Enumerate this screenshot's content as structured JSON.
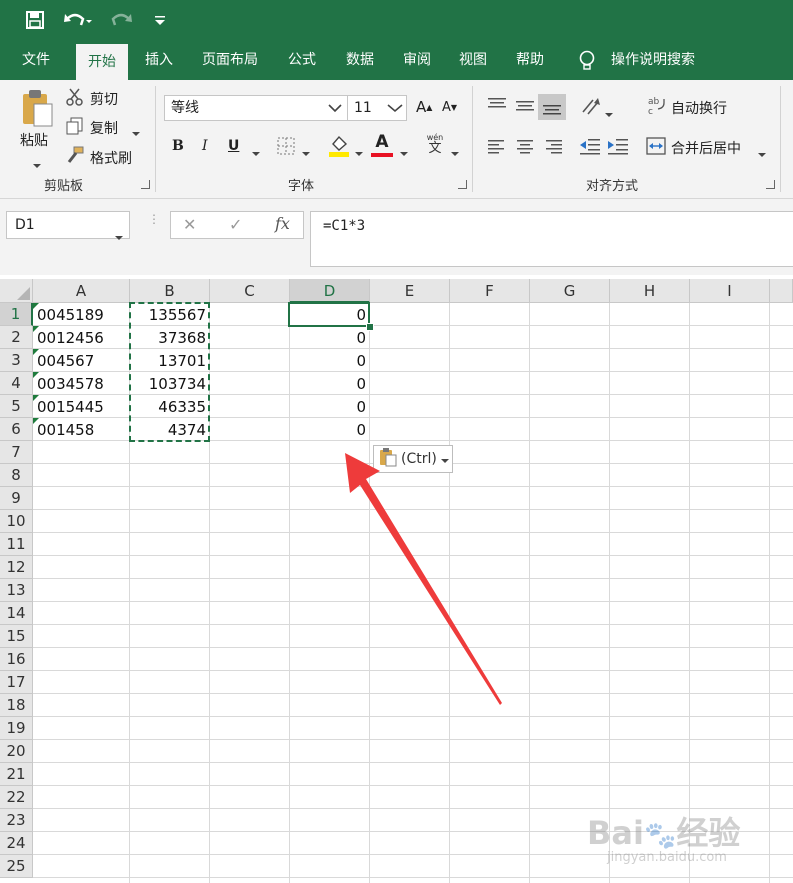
{
  "quick_access": {
    "save_icon": "save-icon",
    "undo_icon": "undo-icon",
    "redo_icon": "redo-icon",
    "customize_icon": "customize-icon"
  },
  "menu": {
    "tabs": [
      "文件",
      "开始",
      "插入",
      "页面布局",
      "公式",
      "数据",
      "审阅",
      "视图",
      "帮助"
    ],
    "active_tab": "开始",
    "tell_me": "操作说明搜索"
  },
  "ribbon": {
    "clipboard": {
      "paste": "粘贴",
      "cut": "剪切",
      "copy": "复制",
      "format_painter": "格式刷",
      "label": "剪贴板"
    },
    "font": {
      "font_name": "等线",
      "font_size": "11",
      "bold": "B",
      "italic": "I",
      "underline": "U",
      "font_color_letter": "A",
      "phonetic": "wén",
      "phonetic_char": "文",
      "label": "字体",
      "grow": "A",
      "shrink": "A"
    },
    "alignment": {
      "wrap_text": "自动换行",
      "merge_center": "合并后居中",
      "label": "对齐方式"
    }
  },
  "formula_bar": {
    "name_box": "D1",
    "cancel": "✕",
    "enter": "✓",
    "fx": "fx",
    "formula": "=C1*3"
  },
  "sheet": {
    "columns": [
      "A",
      "B",
      "C",
      "D",
      "E",
      "F",
      "G",
      "H",
      "I"
    ],
    "rows": [
      "1",
      "2",
      "3",
      "4",
      "5",
      "6",
      "7",
      "8",
      "9",
      "10",
      "11",
      "12",
      "13",
      "14",
      "15",
      "16",
      "17",
      "18",
      "19",
      "20",
      "21",
      "22",
      "23",
      "24",
      "25"
    ],
    "col_a": [
      "0045189",
      "0012456",
      "004567",
      "0034578",
      "0015445",
      "001458"
    ],
    "col_b": [
      "135567",
      "37368",
      "13701",
      "103734",
      "46335",
      "4374"
    ],
    "col_d": [
      "0",
      "0",
      "0",
      "0",
      "0",
      "0"
    ],
    "active_cell": "D1",
    "paste_options": "(Ctrl)"
  },
  "annotation": {
    "arrow_color": "#ee3b3b"
  },
  "watermark": {
    "brand": "Bai",
    "brand2": "经验",
    "site": "jingyan.baidu.com"
  },
  "colors": {
    "accent": "#217346"
  }
}
